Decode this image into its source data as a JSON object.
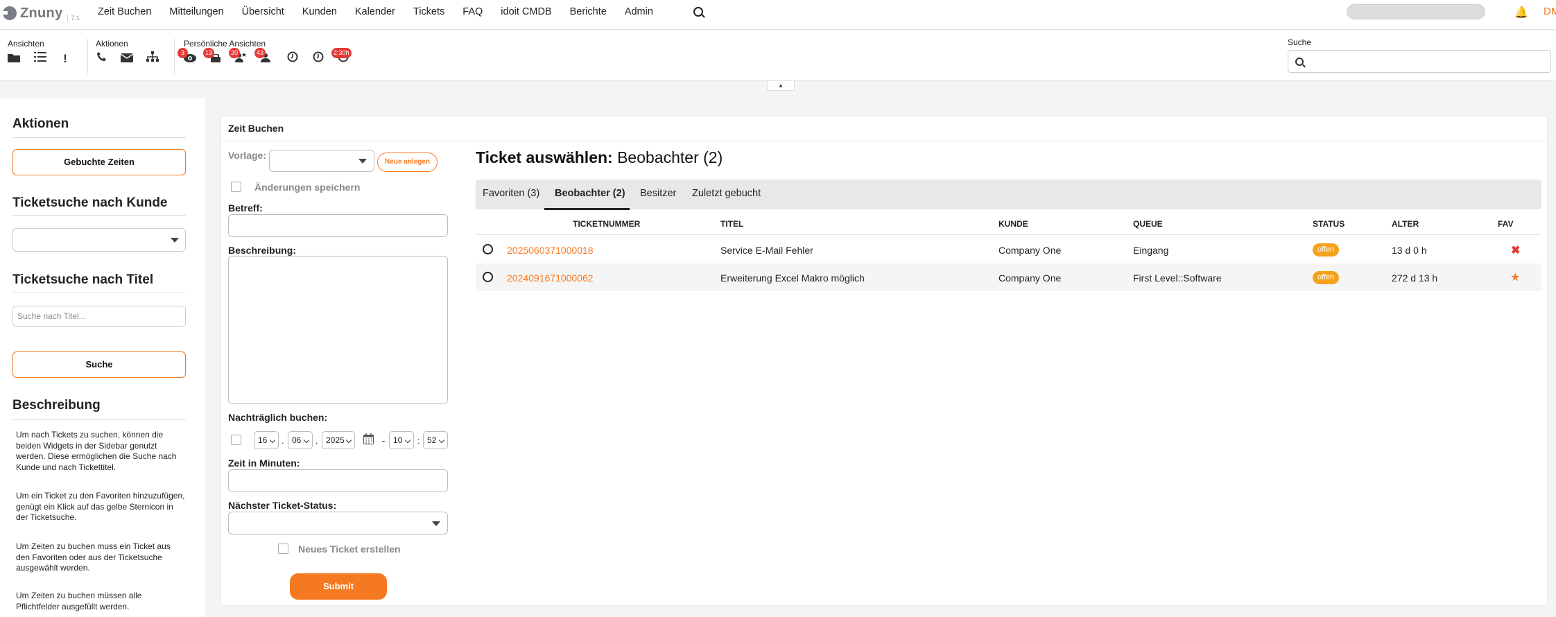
{
  "app": {
    "logo": "Znuny",
    "version": "7.1"
  },
  "nav": {
    "items": [
      "Zeit Buchen",
      "Mitteilungen",
      "Übersicht",
      "Kunden",
      "Kalender",
      "Tickets",
      "FAQ",
      "idoit CMDB",
      "Berichte",
      "Admin"
    ],
    "user_initials": "DM"
  },
  "toolbar": {
    "groups": [
      "Ansichten",
      "Aktionen",
      "Persönliche Ansichten"
    ],
    "badges": [
      "3",
      "13",
      "20",
      "43",
      "2:30h"
    ],
    "search_label": "Suche"
  },
  "sidebar": {
    "aktionen_title": "Aktionen",
    "gebuchte_btn": "Gebuchte Zeiten",
    "kunde_title": "Ticketsuche nach Kunde",
    "titel_title": "Ticketsuche nach Titel",
    "titel_placeholder": "Suche nach Titel...",
    "suche_btn": "Suche",
    "beschreibung_title": "Beschreibung",
    "paragraphs": [
      "Um nach Tickets zu suchen, können die beiden Widgets in der Sidebar genutzt werden. Diese ermöglichen die Suche nach Kunde und nach Tickettitel.",
      "Um ein Ticket zu den Favoriten hinzuzufügen, genügt ein Klick auf das gelbe Sternicon in der Ticketsuche.",
      "Um Zeiten zu buchen muss ein Ticket aus den Favoriten oder aus der Ticketsuche ausgewählt werden.",
      "Um Zeiten zu buchen müssen alle Pflichtfelder ausgefüllt werden."
    ]
  },
  "form": {
    "card_title": "Zeit Buchen",
    "vorlage_label": "Vorlage:",
    "neu_btn": "Neue anlegen",
    "aenderungen": "Änderungen speichern",
    "betreff_label": "Betreff:",
    "beschreibung_label": "Beschreibung:",
    "nachtraeglich_label": "Nachträglich buchen:",
    "day": "16",
    "month": "06",
    "year": "2025",
    "hour": "10",
    "minute": "52",
    "dot": ".",
    "dash": "-",
    "colon": ":",
    "zeit_label": "Zeit in Minuten:",
    "status_label": "Nächster Ticket-Status:",
    "neues_ticket": "Neues Ticket erstellen",
    "submit": "Submit"
  },
  "tickets": {
    "title_bold": "Ticket auswählen:",
    "title_rest": "Beobachter (2)",
    "tabs": [
      "Favoriten (3)",
      "Beobachter (2)",
      "Besitzer",
      "Zuletzt gebucht"
    ],
    "active_tab": "Beobachter (2)",
    "columns": [
      "TICKETNUMMER",
      "TITEL",
      "KUNDE",
      "QUEUE",
      "STATUS",
      "ALTER",
      "FAV"
    ],
    "rows": [
      {
        "number": "2025060371000018",
        "title": "Service E-Mail Fehler",
        "customer": "Company One",
        "queue": "Eingang",
        "status": "offen",
        "age": "13 d 0 h",
        "fav": "remove-icon"
      },
      {
        "number": "2024091671000062",
        "title": "Erweiterung Excel Makro möglich",
        "customer": "Company One",
        "queue": "First Level::Software",
        "status": "offen",
        "age": "272 d 13 h",
        "fav": "star-icon"
      }
    ]
  },
  "colors": {
    "accent": "#f47920",
    "status": "#f4a21c",
    "badge": "#e53935"
  }
}
